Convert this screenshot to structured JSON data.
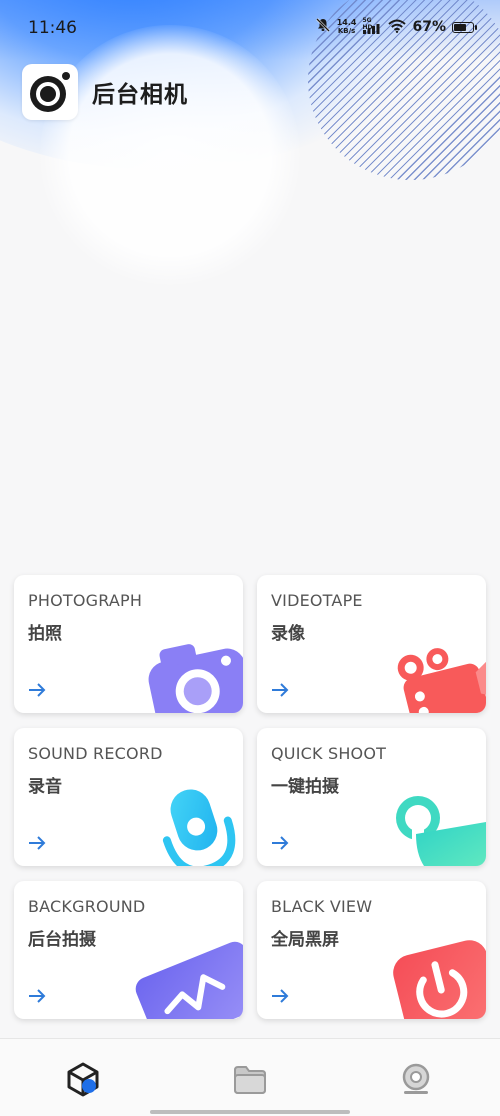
{
  "status_bar": {
    "time": "11:46",
    "net_speed_value": "14.4",
    "net_speed_unit": "KB/s",
    "network_tag": "5G HD",
    "battery_percent": "67%",
    "battery_level": 0.67,
    "icons": [
      "mute-bell-icon",
      "signal-icon",
      "wifi-icon",
      "battery-icon"
    ]
  },
  "header": {
    "app_title": "后台相机",
    "app_icon": "camera-lens-icon"
  },
  "features": [
    {
      "en": "PHOTOGRAPH",
      "zh": "拍照",
      "icon": "camera-icon",
      "color": "#8a7ff5"
    },
    {
      "en": "VIDEOTAPE",
      "zh": "录像",
      "icon": "video-camera-icon",
      "color": "#f85a5a"
    },
    {
      "en": "SOUND RECORD",
      "zh": "录音",
      "icon": "microphone-icon",
      "color": "#2ec5f2"
    },
    {
      "en": "QUICK SHOOT",
      "zh": "一键拍摄",
      "icon": "tap-icon",
      "color": "#3fd9c2"
    },
    {
      "en": "BACKGROUND",
      "zh": "后台拍摄",
      "icon": "wave-card-icon",
      "color": "#7f78f2"
    },
    {
      "en": "BLACK VIEW",
      "zh": "全局黑屏",
      "icon": "power-icon",
      "color": "#f85a5a"
    }
  ],
  "arrow_icon": "arrow-right-icon",
  "arrow_color": "#2f7bd9",
  "bottom_nav": {
    "items": [
      {
        "icon": "home-cube-icon",
        "active": true
      },
      {
        "icon": "folder-icon",
        "active": false
      },
      {
        "icon": "webcam-icon",
        "active": false
      }
    ]
  }
}
